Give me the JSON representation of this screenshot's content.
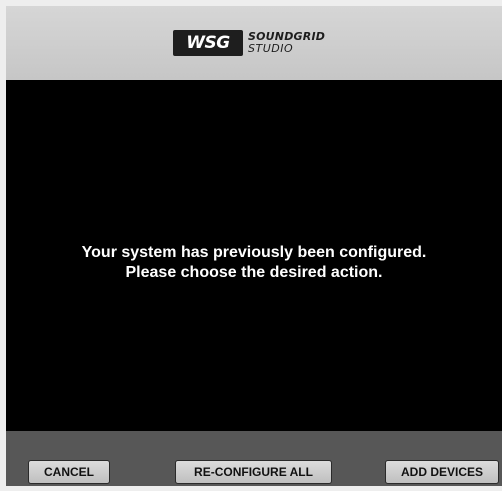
{
  "header": {
    "logo_mark": "WSG",
    "logo_line1": "SOUNDGRID",
    "logo_line2": "STUDIO"
  },
  "message": {
    "line1": "Your system has previously been configured.",
    "line2": "Please choose the desired action."
  },
  "footer": {
    "cancel_label": "CANCEL",
    "reconfigure_label": "RE-CONFIGURE ALL",
    "add_devices_label": "ADD DEVICES"
  },
  "colors": {
    "header_bg": "#cccccc",
    "body_bg": "#000000",
    "footer_bg": "#575757",
    "button_bg": "#cfcfcf",
    "text": "#ffffff"
  }
}
